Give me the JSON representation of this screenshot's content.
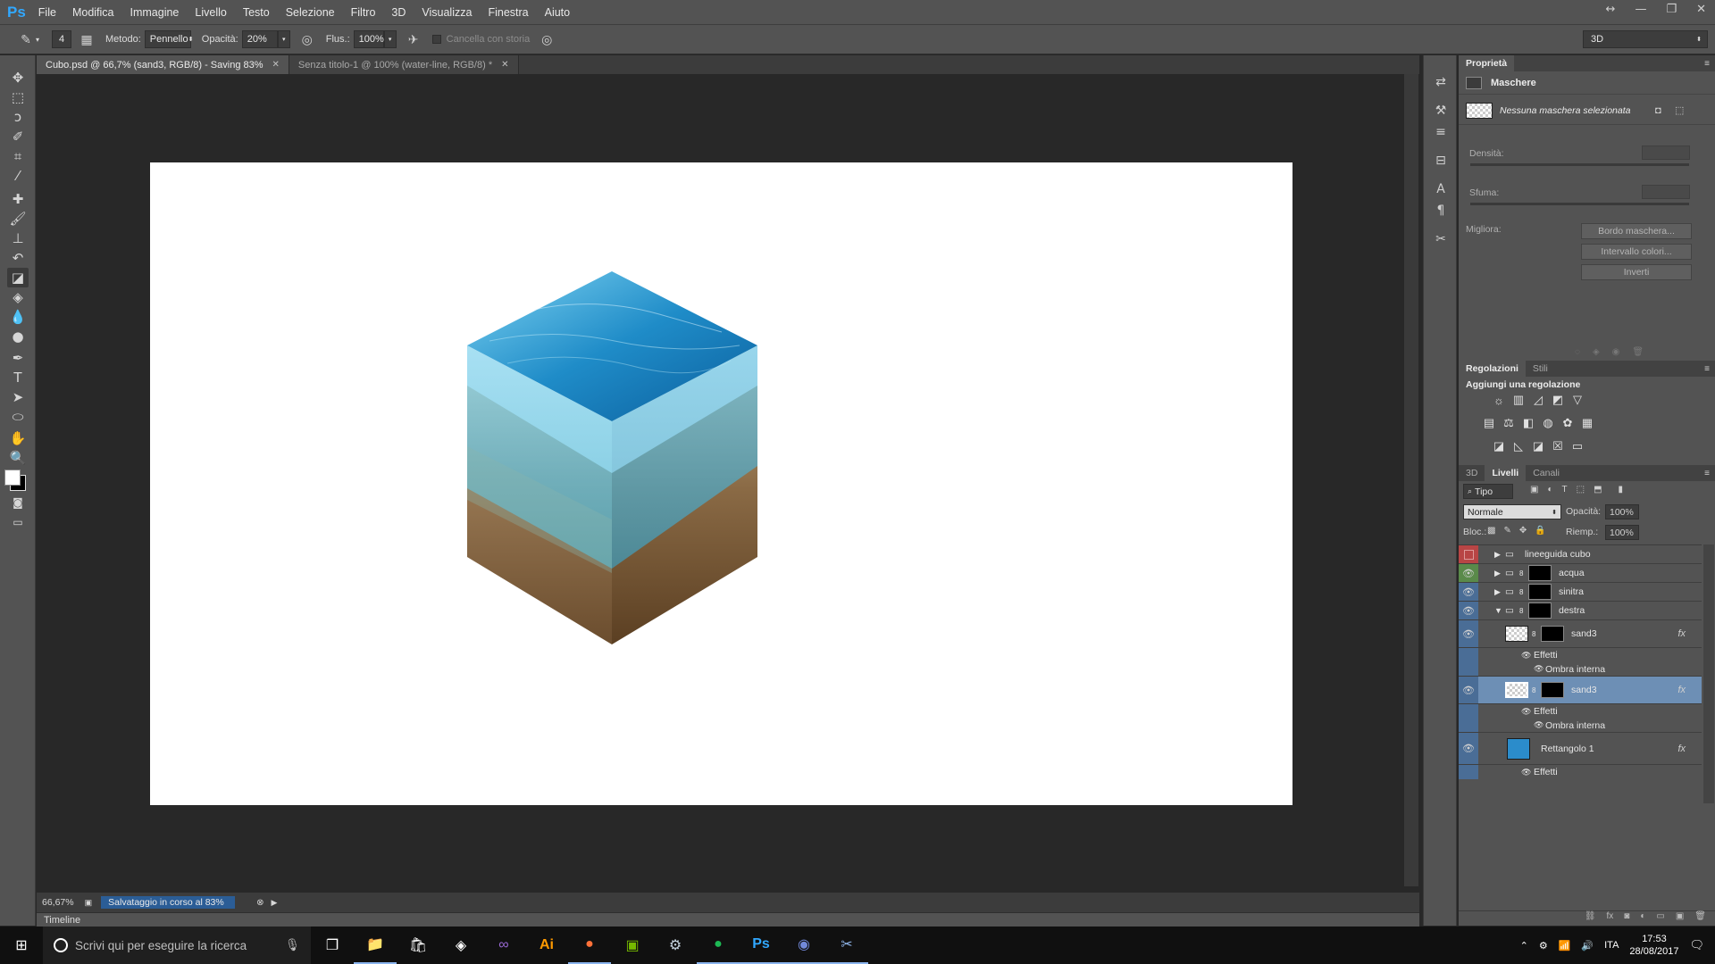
{
  "app": {
    "logo": "Ps"
  },
  "menu": [
    "File",
    "Modifica",
    "Immagine",
    "Livello",
    "Testo",
    "Selezione",
    "Filtro",
    "3D",
    "Visualizza",
    "Finestra",
    "Aiuto"
  ],
  "options_bar": {
    "brush_size": "4",
    "method_label": "Metodo:",
    "method_value": "Pennello",
    "opacity_label": "Opacità:",
    "opacity_value": "20%",
    "flow_label": "Flus.:",
    "flow_value": "100%",
    "erase_history_label": "Cancella con storia",
    "workspace": "3D"
  },
  "tabs": [
    {
      "label": "Cubo.psd @ 66,7% (sand3, RGB/8) - Saving 83%",
      "active": true
    },
    {
      "label": "Senza titolo-1 @ 100% (water-line, RGB/8) *",
      "active": false
    }
  ],
  "status": {
    "zoom": "66,67%",
    "progress_text": "Salvataggio in corso al 83%",
    "progress": 0.83
  },
  "timeline_label": "Timeline",
  "properties": {
    "tab": "Proprietà",
    "section": "Maschere",
    "mask_status": "Nessuna maschera selezionata",
    "density_label": "Densità:",
    "feather_label": "Sfuma:",
    "refine_label": "Migliora:",
    "buttons": [
      "Bordo maschera...",
      "Intervallo colori...",
      "Inverti"
    ]
  },
  "adjustments": {
    "tabs": [
      "Regolazioni",
      "Stili"
    ],
    "title": "Aggiungi una regolazione"
  },
  "layers_panel": {
    "tabs": [
      "3D",
      "Livelli",
      "Canali"
    ],
    "filter_kind": "Tipo",
    "blend_mode": "Normale",
    "opacity_label": "Opacità:",
    "opacity_value": "100%",
    "lock_label": "Bloc.:",
    "fill_label": "Riemp.:",
    "fill_value": "100%",
    "layers": [
      {
        "name": "lineeguida cubo",
        "type": "group"
      },
      {
        "name": "acqua",
        "type": "group"
      },
      {
        "name": "sinitra",
        "type": "group"
      },
      {
        "name": "destra",
        "type": "group"
      },
      {
        "name": "sand3",
        "type": "layer"
      },
      {
        "name": "Effetti",
        "type": "effects"
      },
      {
        "name": "Ombra interna",
        "type": "effect"
      },
      {
        "name": "sand3",
        "type": "layer"
      },
      {
        "name": "Effetti",
        "type": "effects"
      },
      {
        "name": "Ombra interna",
        "type": "effect"
      },
      {
        "name": "Rettangolo 1",
        "type": "shape"
      },
      {
        "name": "Effetti",
        "type": "effects"
      }
    ],
    "fx_label": "fx"
  },
  "taskbar": {
    "search_placeholder": "Scrivi qui per eseguire la ricerca",
    "language": "ITA",
    "time": "17:53",
    "date": "28/08/2017"
  },
  "colors": {
    "ps_blue": "#31a8ff",
    "panel_bg": "#535353",
    "selected_layer": "#4a6d96",
    "progress_blue": "#2b5d96"
  }
}
